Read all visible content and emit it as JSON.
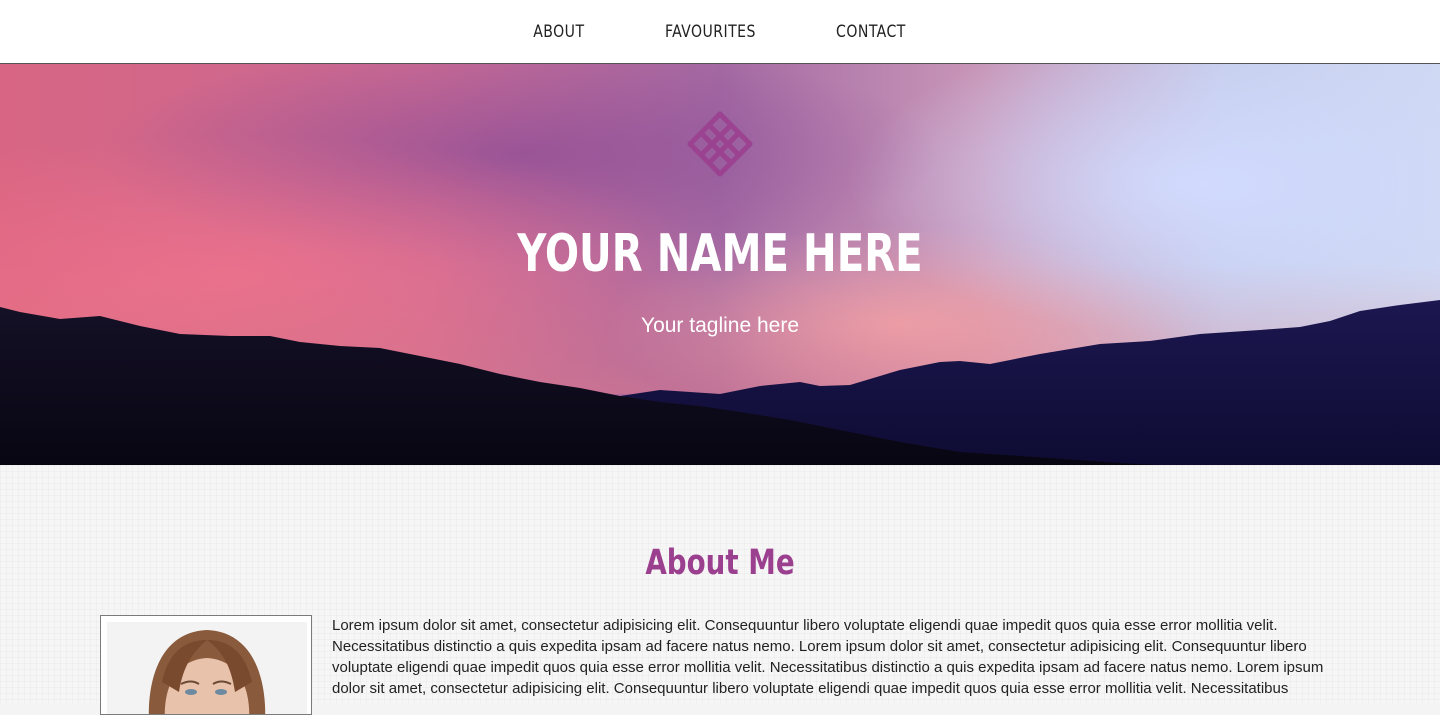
{
  "nav": {
    "items": [
      {
        "label": "ABOUT"
      },
      {
        "label": "FAVOURITES"
      },
      {
        "label": "CONTACT"
      }
    ]
  },
  "hero": {
    "logo_icon": "crosshatch-logo-icon",
    "title": "YOUR NAME HERE",
    "tagline": "Your tagline here"
  },
  "about": {
    "title": "About Me",
    "bio": "Lorem ipsum dolor sit amet, consectetur adipisicing elit. Consequuntur libero voluptate eligendi quae impedit quos quia esse error mollitia velit. Necessitatibus distinctio a quis expedita ipsam ad facere natus nemo. Lorem ipsum dolor sit amet, consectetur adipisicing elit. Consequuntur libero voluptate eligendi quae impedit quos quia esse error mollitia velit. Necessitatibus distinctio a quis expedita ipsam ad facere natus nemo. Lorem ipsum dolor sit amet, consectetur adipisicing elit. Consequuntur libero voluptate eligendi quae impedit quos quia esse error mollitia velit. Necessitatibus distinctio a quis"
  },
  "colors": {
    "accent": "#9b3f8f",
    "nav_text": "#222222",
    "hero_text": "#ffffff"
  }
}
